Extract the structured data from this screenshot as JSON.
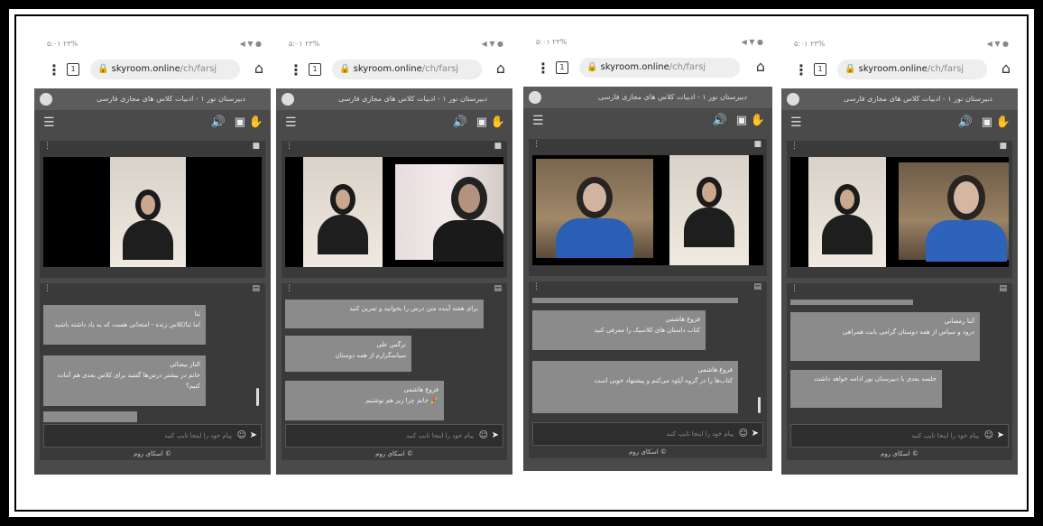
{
  "status_left": "۵:۰۱ ۲۳%",
  "status_right": "◀ ▼ ●",
  "browser": {
    "menu_icon": "⋮",
    "tab_count": "1",
    "url_domain": "skyroom.online",
    "url_path": "/ch/farsj",
    "home_icon": "⌂"
  },
  "room_title": "دبیرستان نور ۱ - ادبیات کلاس های مجازی فارسی",
  "input_placeholder": "پیام خود را اینجا تایپ کنید",
  "footer": "اسکای روم ©",
  "phones": [
    {
      "messages": [
        {
          "name": "ثنا",
          "text": "اما ثنا/کلاس زنده - امتحانی هست که به یاد داشته باشید"
        },
        {
          "name": "الناز بیضائی",
          "text": "خانم در بیشتر درس‌ها گفتید برای کلاس بعدی هم آماده کنیم؟"
        }
      ]
    },
    {
      "messages": [
        {
          "name": "",
          "text": "برای هفته آینده متن درس را بخوانید و تمرین کنید"
        },
        {
          "name": "نرگس علی",
          "text": "سپاسگزارم از همه دوستان"
        },
        {
          "name": "فروغ هاشمی",
          "text": "خانم چرا زیر هم نوشتیم 🎉"
        }
      ]
    },
    {
      "messages": [
        {
          "name": "فروغ هاشمی",
          "text": "کتاب داستان های کلاسیک را معرفی کنید"
        },
        {
          "name": "فروغ هاشمی",
          "text": "کتاب‌ها را در گروه آپلود می‌کنم و پیشنهاد خوبی است"
        }
      ]
    },
    {
      "messages": [
        {
          "name": "آتنا رمضانی",
          "text": "درود و سپاس از همه دوستان گرامی بابت همراهی"
        },
        {
          "name": "",
          "text": "جلسه بعدی با دبیرستان نور ادامه خواهد داشت"
        }
      ]
    }
  ]
}
